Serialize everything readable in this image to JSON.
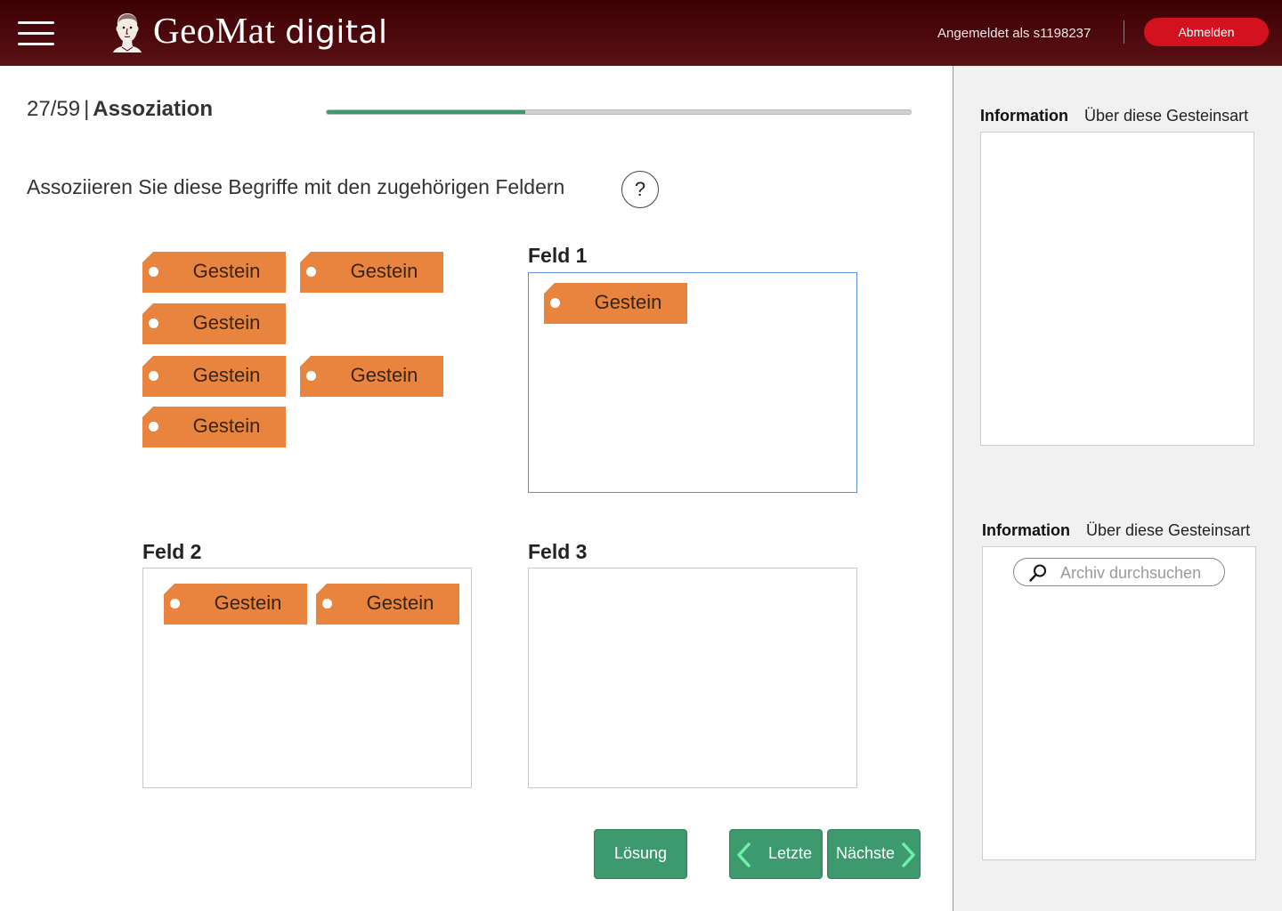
{
  "header": {
    "app_name": "GeoMat",
    "app_name_suffix": "digital",
    "user_label": "Angemeldet als s1198237",
    "logout_label": "Abmelden"
  },
  "exercise": {
    "counter": "27/59",
    "separator": "|",
    "type_label": "Assoziation",
    "progress_fraction": 0.34,
    "instruction": "Assoziieren Sie diese Begriffe mit den zugehörigen Feldern",
    "help_label": "?"
  },
  "pool_tags": [
    "Gestein",
    "Gestein",
    "Gestein",
    "Gestein",
    "Gestein",
    "Gestein"
  ],
  "fields": [
    {
      "title": "Feld 1",
      "tags": [
        "Gestein"
      ]
    },
    {
      "title": "Feld 2",
      "tags": [
        "Gestein",
        "Gestein"
      ]
    },
    {
      "title": "Feld 3",
      "tags": []
    }
  ],
  "buttons": {
    "solution": "Lösung",
    "previous": "Letzte",
    "next": "Nächste"
  },
  "sidebar": {
    "panel1": {
      "tab_active": "Information",
      "tab_other": "Über diese Gesteinsart"
    },
    "panel2": {
      "tab_active": "Information",
      "tab_other": "Über diese Gesteinsart",
      "search_placeholder": "Archiv durchsuchen"
    }
  },
  "colors": {
    "header_bg": "#4e0a0e",
    "logout_red": "#d4121f",
    "tag_orange": "#e8843d",
    "button_green": "#3d9a6e",
    "progress_green": "#3e9a6b",
    "active_field_border": "#5b8fd6"
  }
}
